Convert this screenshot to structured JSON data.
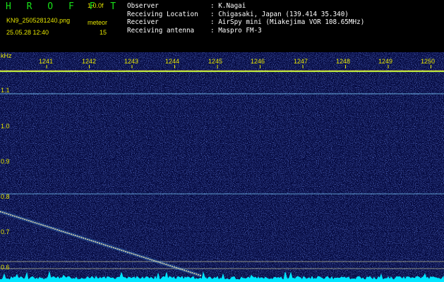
{
  "header": {
    "brand": "H R O F F T",
    "version": "1.0.0f",
    "filename": "KN9_2505281240.png",
    "mode": "meteor",
    "timestamp": "25.05.28 12:40",
    "count": "15"
  },
  "info": [
    {
      "label": "Observer",
      "value": ": K.Nagai"
    },
    {
      "label": "Receiving Location",
      "value": ": Chigasaki, Japan (139.414 35.340)"
    },
    {
      "label": "Receiver",
      "value": ": AirSpy mini (Miakejima VOR 108.65MHz)"
    },
    {
      "label": "Receiving antenna",
      "value": ": Maspro FM-3"
    }
  ],
  "plot": {
    "unit": "kHz",
    "y_ticks": [
      "1.1",
      "1.0",
      "0.9",
      "0.8",
      "0.7",
      "0.6"
    ],
    "x_ticks": [
      "1241",
      "1242",
      "1243",
      "1244",
      "1245",
      "1246",
      "1247",
      "1248",
      "1249",
      "1250"
    ],
    "colors": {
      "background": "#050a40",
      "label": "#e6e600",
      "trace": "#00e5ff"
    }
  }
}
